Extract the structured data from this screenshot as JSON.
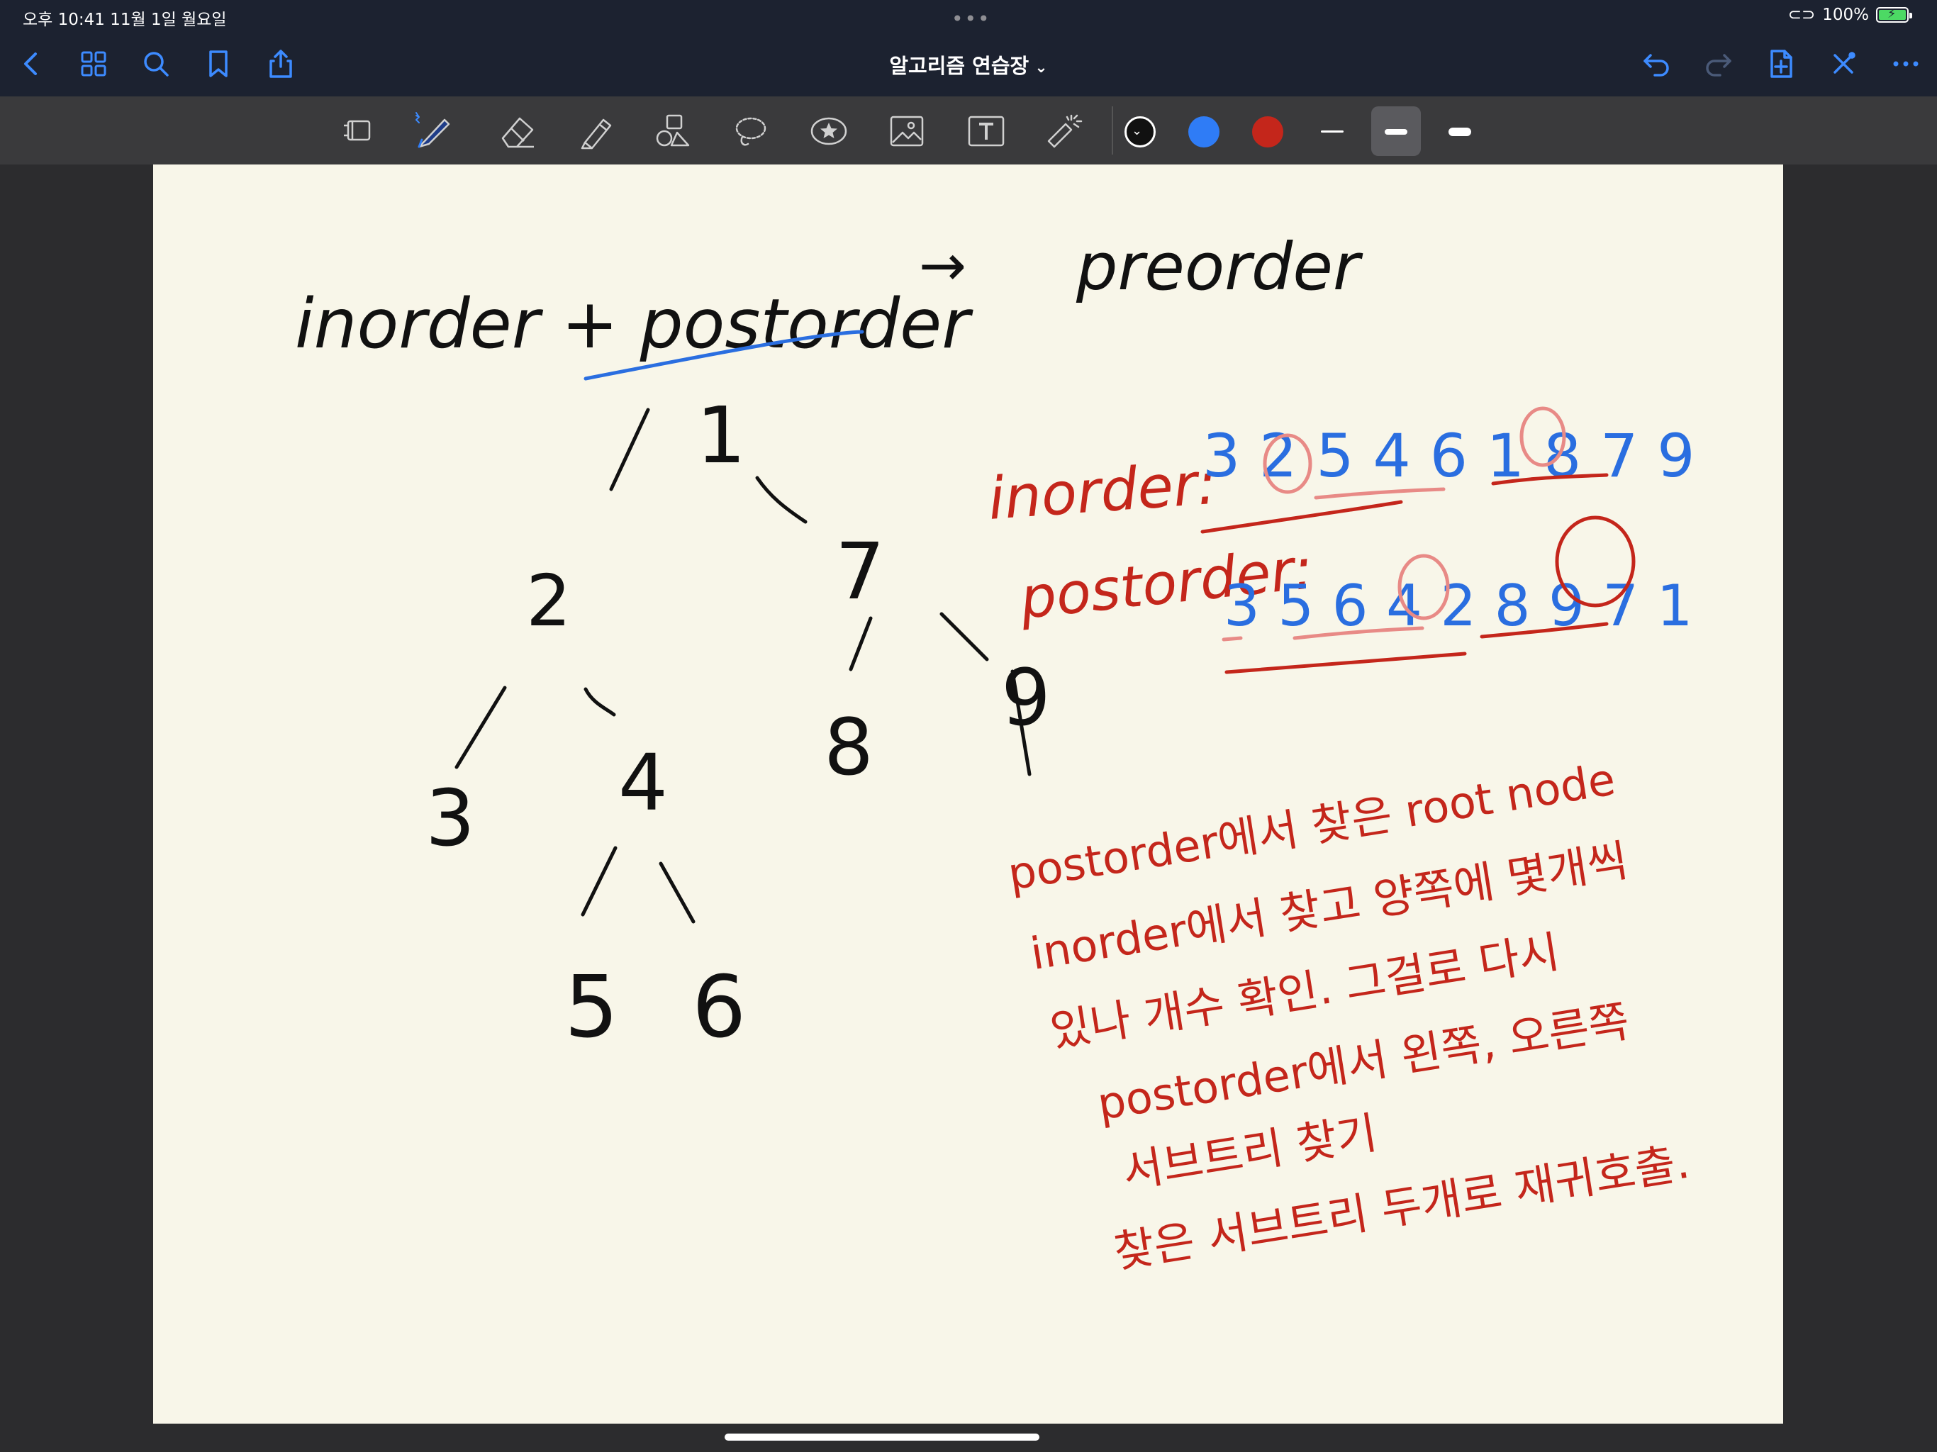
{
  "status_bar": {
    "time_date": "오후 10:41   11월 1일 월요일",
    "battery": "100%"
  },
  "nav": {
    "title": "알고리즘 연습장"
  },
  "toolbar": {
    "colors": [
      "#111111",
      "#2f7cf6",
      "#c4261b"
    ],
    "selected_color_index": 0,
    "selected_width_index": 1
  },
  "note": {
    "heading_left": "inorder + postorder",
    "heading_arrow": "→",
    "heading_right": "preorder",
    "tree_nodes": [
      "1",
      "2",
      "7",
      "3",
      "4",
      "8",
      "9",
      "5",
      "6"
    ],
    "inorder_label": "inorder:",
    "inorder_seq": "3 2 5 4 6 1 8 7 9",
    "postorder_label": "postorder:",
    "postorder_seq": "3 5 6 4 2 8 9 7 1",
    "explanation": [
      "postorder에서 찾은 root node",
      "inorder에서 찾고 양쪽에 몇개씩",
      "있나 개수 확인. 그걸로 다시",
      "postorder에서 왼쪽, 오른쪽",
      "서브트리 찾기",
      "찾은 서브트리 두개로 재귀호출."
    ]
  }
}
